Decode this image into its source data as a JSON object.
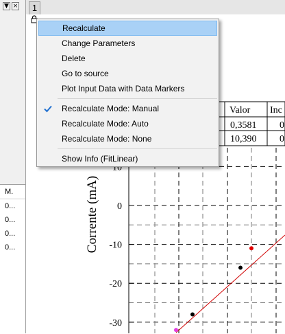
{
  "left_panel": {
    "window_buttons": [
      "▼",
      "×"
    ],
    "list_header": "M.",
    "list_rows": [
      "0...",
      "0...",
      "0...",
      "0..."
    ]
  },
  "tab": {
    "label": "1"
  },
  "table": {
    "headers": [
      "Valor",
      "Inc"
    ],
    "rows": [
      {
        "valor": "0,3581",
        "inc": "0"
      },
      {
        "valor": "10,390",
        "inc": "0"
      }
    ]
  },
  "context_menu": {
    "items": [
      {
        "label": "Recalculate",
        "highlighted": true
      },
      {
        "label": "Change Parameters"
      },
      {
        "label": "Delete"
      },
      {
        "label": "Go to source"
      },
      {
        "label": "Plot Input Data with Data Markers"
      },
      {
        "label": "Recalculate Mode: Manual",
        "checked": true
      },
      {
        "label": "Recalculate Mode: Auto"
      },
      {
        "label": "Recalculate Mode: None"
      },
      {
        "label": "Show Info (FitLinear)"
      }
    ]
  },
  "chart_data": {
    "type": "scatter",
    "ylabel": "Corrente (mA)",
    "yticks": [
      "10",
      "0",
      "-10",
      "-20",
      "-30"
    ],
    "points": [
      {
        "y": -32,
        "color": "#e040e0"
      },
      {
        "y": -28,
        "color": "#000000"
      },
      {
        "y": -16,
        "color": "#000000"
      },
      {
        "y": -11,
        "color": "#e00000"
      }
    ],
    "fit_line": {
      "color": "#d00000"
    },
    "grid": true
  }
}
